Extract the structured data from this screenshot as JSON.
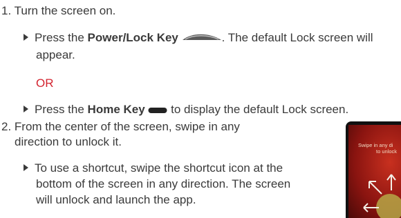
{
  "step1": {
    "number": "1.",
    "text": "Turn the screen on."
  },
  "bullet_power": {
    "before": "Press the ",
    "key": "Power/Lock Key",
    "after": ". The default Lock screen will",
    "cont": "appear.",
    "key_icon": "power-lock-key-icon"
  },
  "or_label": "OR",
  "bullet_home": {
    "before": "Press the ",
    "key": "Home Key",
    "after": " to display the default Lock screen.",
    "key_icon": "home-key-icon"
  },
  "step2": {
    "number": "2.",
    "line1": "From the center of the screen, swipe in any",
    "line2": "direction to unlock it."
  },
  "bullet_shortcut": {
    "line1": "To use a shortcut, swipe the shortcut icon at the",
    "line2": "bottom of the screen in any direction. The screen",
    "line3": "will unlock and launch the app."
  },
  "phone_image": {
    "line1": "Swipe in any di",
    "line2": "to unlock"
  },
  "colors": {
    "text": "#3a3a3a",
    "accent_red": "#d3232f"
  }
}
